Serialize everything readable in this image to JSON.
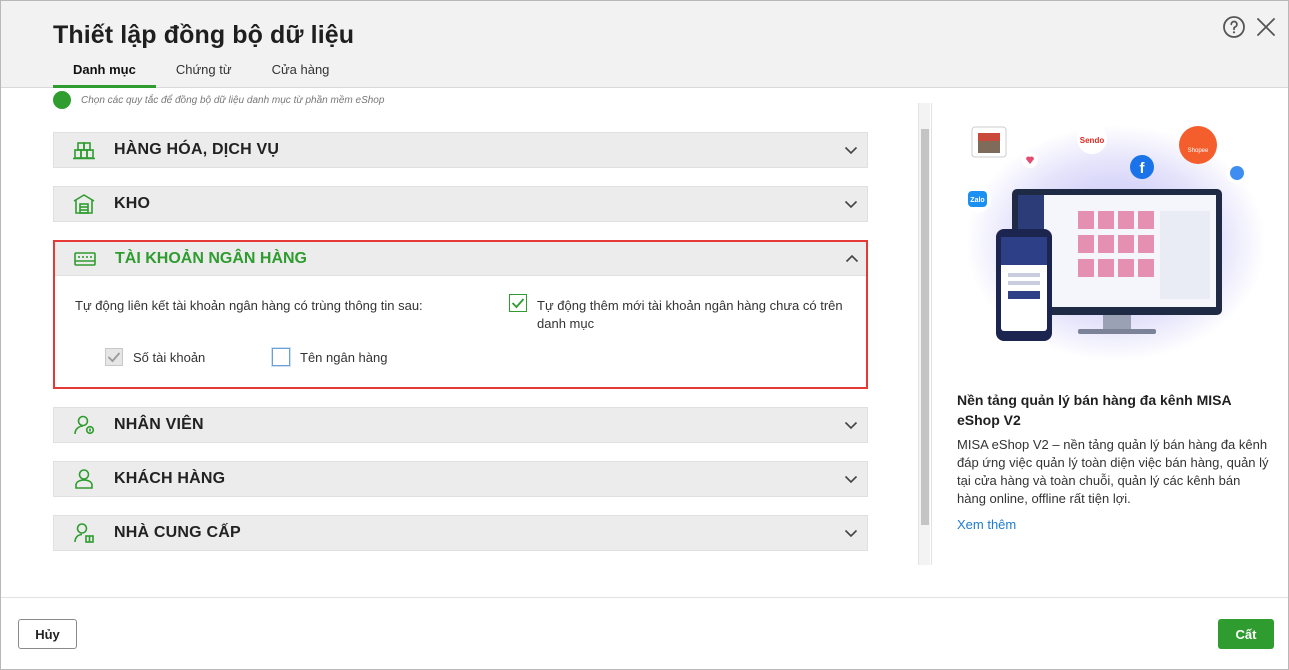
{
  "dialog": {
    "title": "Thiết lập đồng bộ dữ liệu",
    "tabs": [
      {
        "label": "Danh mục",
        "active": true
      },
      {
        "label": "Chứng từ",
        "active": false
      },
      {
        "label": "Cửa hàng",
        "active": false
      }
    ],
    "icons": {
      "help": "help-icon",
      "close": "close-icon"
    }
  },
  "hint": "Chọn các quy tắc để đồng bộ dữ liệu danh mục từ phần mềm eShop",
  "sections": [
    {
      "label": "HÀNG HÓA, DỊCH VỤ",
      "icon": "goods-icon",
      "expanded": false
    },
    {
      "label": "KHO",
      "icon": "warehouse-icon",
      "expanded": false
    },
    {
      "label": "TÀI KHOẢN NGÂN HÀNG",
      "icon": "bank-card-icon",
      "expanded": true
    },
    {
      "label": "NHÂN VIÊN",
      "icon": "employee-icon",
      "expanded": false
    },
    {
      "label": "KHÁCH HÀNG",
      "icon": "customer-icon",
      "expanded": false
    },
    {
      "label": "NHÀ CUNG CẤP",
      "icon": "supplier-icon",
      "expanded": false
    }
  ],
  "bank": {
    "auto_link_text": "Tự động liên kết tài khoản ngân hàng có trùng thông tin sau:",
    "auto_add_text": "Tự động thêm mới tài khoản ngân hàng chưa có trên danh mục",
    "auto_add_checked": true,
    "match_options": [
      {
        "label": "Số tài khoản",
        "checked": true,
        "disabled": true
      },
      {
        "label": "Tên ngân hàng",
        "checked": false,
        "disabled": false
      }
    ]
  },
  "promo": {
    "title": "Nền tảng quản lý bán hàng đa kênh MISA eShop V2",
    "description": "MISA eShop V2 – nền tảng quản lý bán hàng đa kênh đáp ứng việc quản lý toàn diện việc bán hàng, quản lý tại cửa hàng và toàn chuỗi, quản lý các kênh bán hàng online, offline rất tiện lợi.",
    "link": "Xem thêm",
    "illustration_badges": [
      "Sendo",
      "Shopee",
      "Zalo",
      "f"
    ]
  },
  "footer": {
    "cancel_label": "Hủy",
    "save_label": "Cất"
  },
  "colors": {
    "accent": "#2e9c2e",
    "highlight_border": "#e53935",
    "link": "#1e7bd4"
  }
}
